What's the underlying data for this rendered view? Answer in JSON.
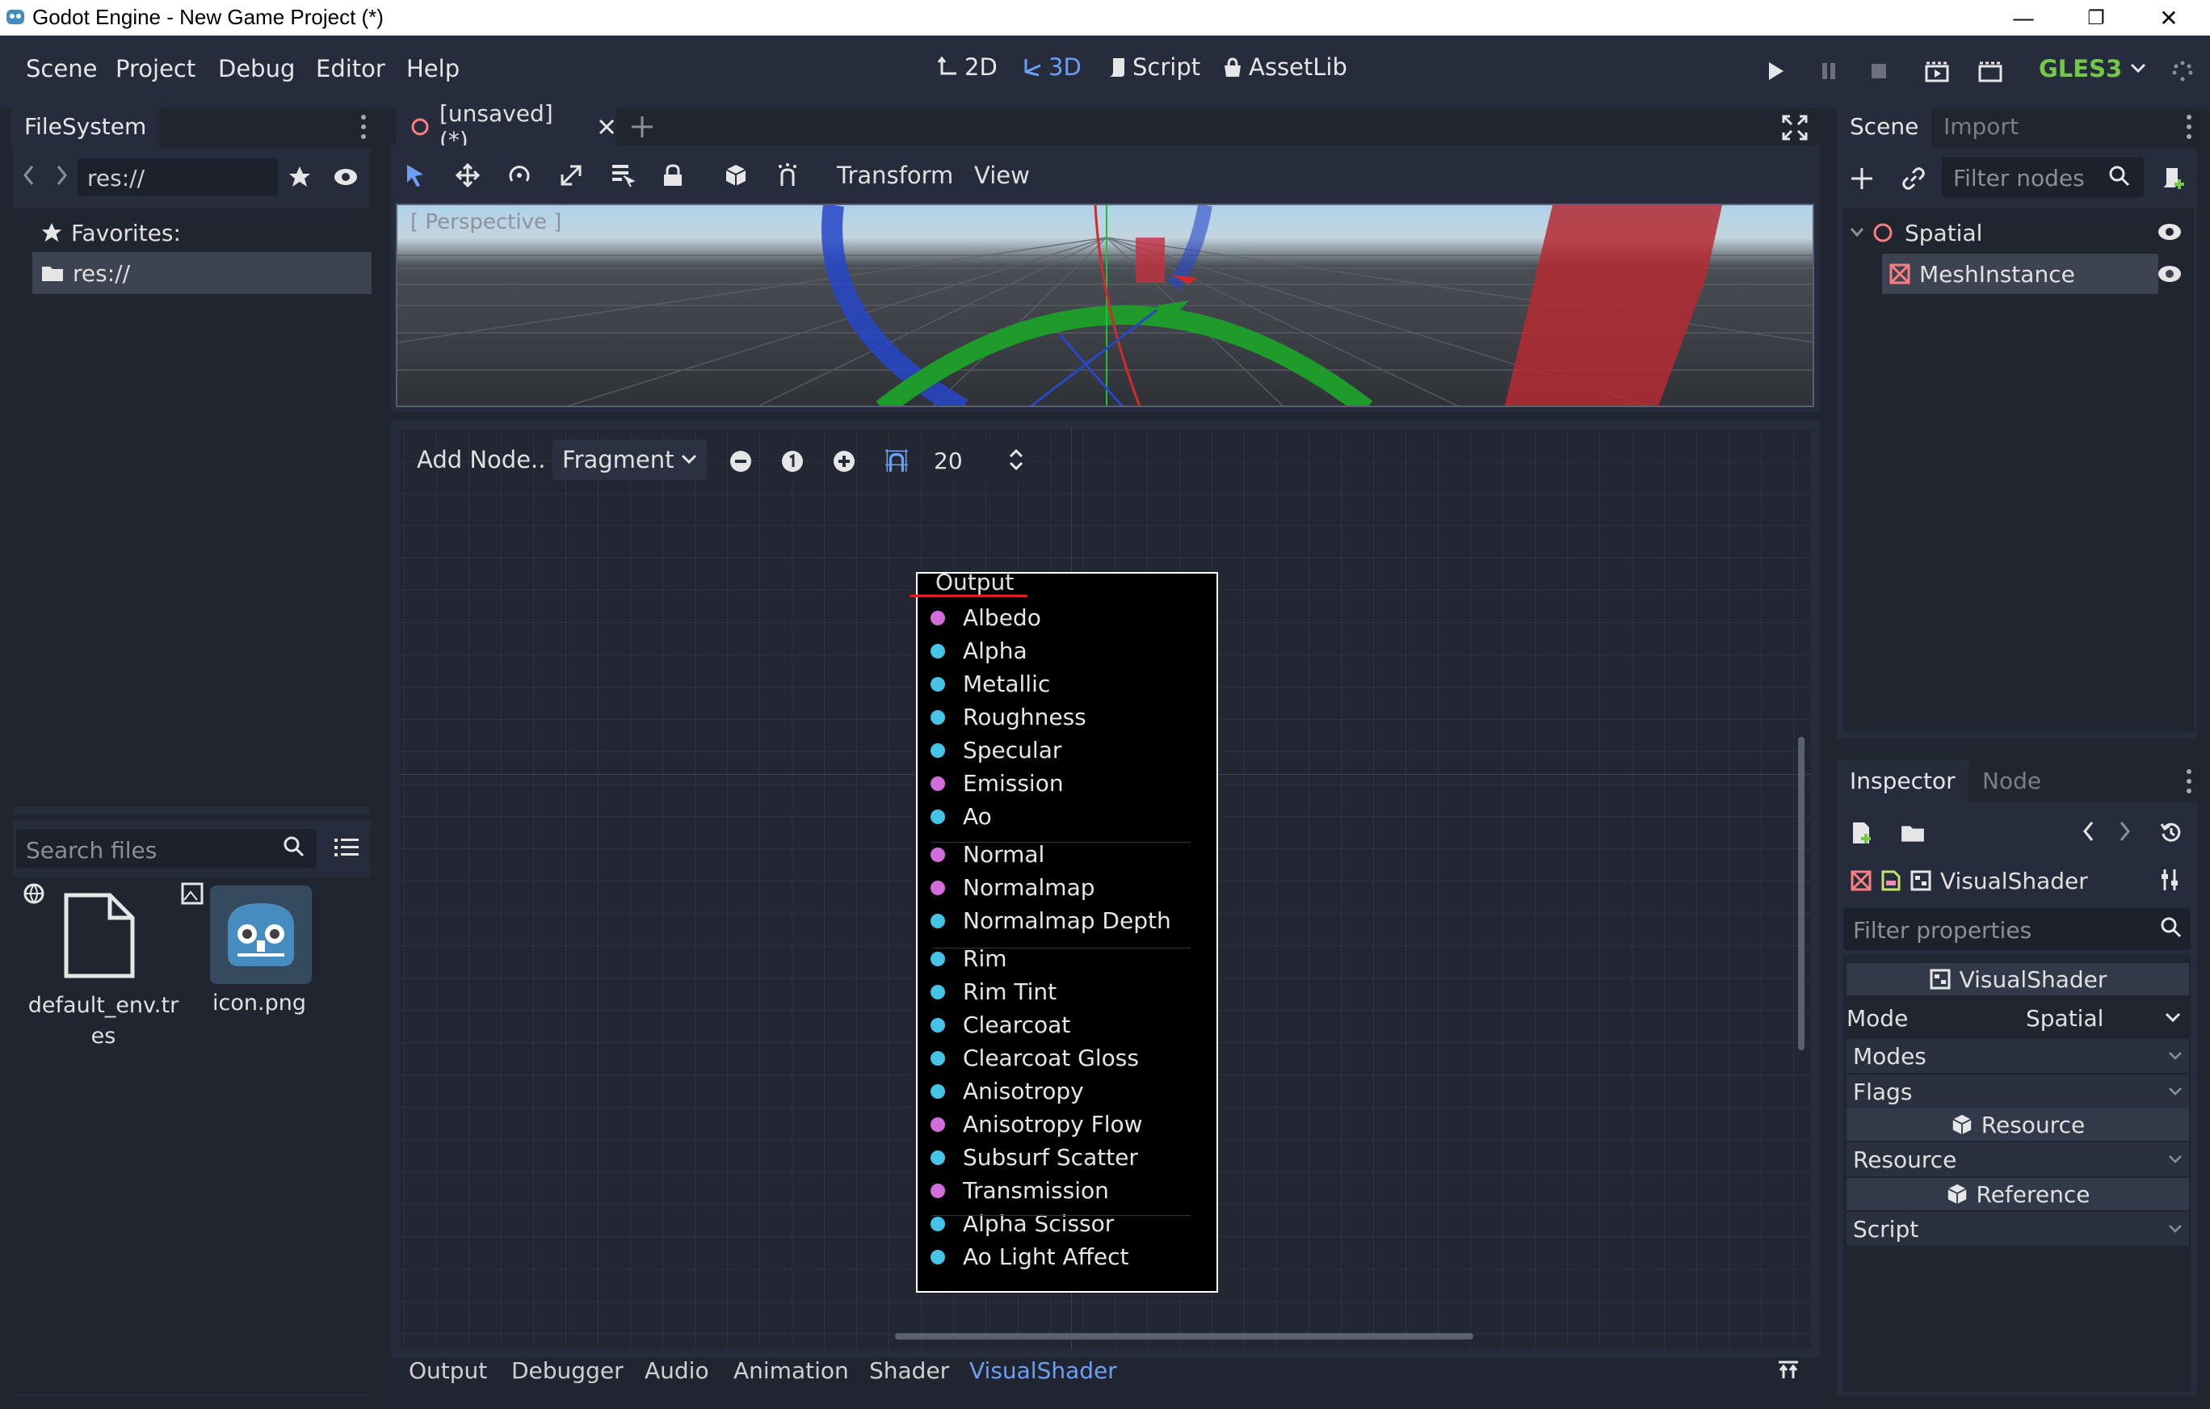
{
  "window": {
    "title": "Godot Engine - New Game Project (*)"
  },
  "menu": {
    "items": [
      "Scene",
      "Project",
      "Debug",
      "Editor",
      "Help"
    ]
  },
  "workspaces": {
    "items": [
      "2D",
      "3D",
      "Script",
      "AssetLib"
    ],
    "active": "3D"
  },
  "renderer": {
    "label": "GLES3",
    "color": "#73c84a"
  },
  "filesystem": {
    "tab": "FileSystem",
    "path": "res://",
    "tree": {
      "favorites": "Favorites:",
      "root": "res://"
    },
    "search_placeholder": "Search files",
    "files": [
      {
        "name": "default_env.tres",
        "icon": "file-icon"
      },
      {
        "name": "icon.png",
        "icon": "godot-icon"
      }
    ]
  },
  "editor": {
    "scene_tab": "[unsaved](*)",
    "toolbar": {
      "transform": "Transform",
      "view": "View"
    },
    "viewport_label": "[ Perspective ]"
  },
  "shader": {
    "toolbar": {
      "add_node": "Add Node..",
      "mode": "Fragment",
      "zoom": "20"
    },
    "output_node": {
      "title": "Output",
      "ports": [
        {
          "name": "Albedo",
          "color": "#d46ddc"
        },
        {
          "name": "Alpha",
          "color": "#45c4e8"
        },
        {
          "name": "Metallic",
          "color": "#45c4e8"
        },
        {
          "name": "Roughness",
          "color": "#45c4e8"
        },
        {
          "name": "Specular",
          "color": "#45c4e8"
        },
        {
          "name": "Emission",
          "color": "#d46ddc"
        },
        {
          "name": "Ao",
          "color": "#45c4e8"
        },
        {
          "name": "Normal",
          "color": "#d46ddc"
        },
        {
          "name": "Normalmap",
          "color": "#d46ddc"
        },
        {
          "name": "Normalmap Depth",
          "color": "#45c4e8"
        },
        {
          "name": "Rim",
          "color": "#45c4e8"
        },
        {
          "name": "Rim Tint",
          "color": "#45c4e8"
        },
        {
          "name": "Clearcoat",
          "color": "#45c4e8"
        },
        {
          "name": "Clearcoat Gloss",
          "color": "#45c4e8"
        },
        {
          "name": "Anisotropy",
          "color": "#45c4e8"
        },
        {
          "name": "Anisotropy Flow",
          "color": "#d46ddc"
        },
        {
          "name": "Subsurf Scatter",
          "color": "#45c4e8"
        },
        {
          "name": "Transmission",
          "color": "#d46ddc"
        },
        {
          "name": "Alpha Scissor",
          "color": "#45c4e8"
        },
        {
          "name": "Ao Light Affect",
          "color": "#45c4e8"
        }
      ]
    }
  },
  "bottom_tabs": {
    "items": [
      "Output",
      "Debugger",
      "Audio",
      "Animation",
      "Shader",
      "VisualShader"
    ],
    "active": "VisualShader"
  },
  "scene_dock": {
    "tabs": [
      "Scene",
      "Import"
    ],
    "filter_placeholder": "Filter nodes",
    "tree": [
      {
        "name": "Spatial"
      },
      {
        "name": "MeshInstance"
      }
    ]
  },
  "inspector": {
    "tabs": [
      "Inspector",
      "Node"
    ],
    "object": "VisualShader",
    "filter_placeholder": "Filter properties",
    "sections": {
      "visual_shader": "VisualShader",
      "mode_label": "Mode",
      "mode_value": "Spatial",
      "modes": "Modes",
      "flags": "Flags",
      "resource_section": "Resource",
      "resource_row": "Resource",
      "reference_section": "Reference",
      "script_row": "Script"
    }
  }
}
